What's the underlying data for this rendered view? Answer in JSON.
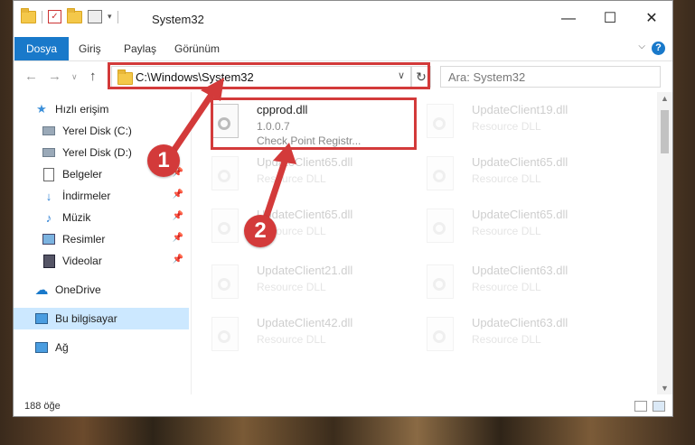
{
  "window": {
    "title": "System32",
    "controls": {
      "minimize": "—",
      "maximize": "☐",
      "close": "✕"
    }
  },
  "ribbon": {
    "tabs": [
      "Dosya",
      "Giriş",
      "Paylaş",
      "Görünüm"
    ],
    "help": "?"
  },
  "address": {
    "path": "C:\\Windows\\System32",
    "search_placeholder": "Ara: System32"
  },
  "nav": {
    "items": [
      {
        "label": "Hızlı erişim",
        "icon": "star-icon",
        "pinned": false
      },
      {
        "label": "Yerel Disk (C:)",
        "icon": "drive-icon",
        "pinned": false
      },
      {
        "label": "Yerel Disk (D:)",
        "icon": "drive-icon",
        "pinned": false
      },
      {
        "label": "Belgeler",
        "icon": "documents-icon",
        "pinned": true
      },
      {
        "label": "İndirmeler",
        "icon": "download-icon",
        "pinned": true
      },
      {
        "label": "Müzik",
        "icon": "music-icon",
        "pinned": true
      },
      {
        "label": "Resimler",
        "icon": "pictures-icon",
        "pinned": true
      },
      {
        "label": "Videolar",
        "icon": "videos-icon",
        "pinned": true
      },
      {
        "label": "OneDrive",
        "icon": "cloud-icon",
        "pinned": false
      },
      {
        "label": "Bu bilgisayar",
        "icon": "computer-icon",
        "pinned": false,
        "selected": true
      },
      {
        "label": "Ağ",
        "icon": "network-icon",
        "pinned": false
      }
    ]
  },
  "files": [
    {
      "name": "cpprod.dll",
      "line2": "1.0.0.7",
      "line3": "Check Point Registr..."
    },
    {
      "name": "UpdateClient19.dll",
      "line2": "Resource DLL"
    },
    {
      "name": "UpdateClient65.dll",
      "line2": "Resource DLL"
    },
    {
      "name": "UpdateClient65.dll",
      "line2": "Resource DLL"
    },
    {
      "name": "UpdateClient65.dll",
      "line2": "Resource DLL"
    },
    {
      "name": "UpdateClient65.dll",
      "line2": "Resource DLL"
    },
    {
      "name": "UpdateClient21.dll",
      "line2": "Resource DLL"
    },
    {
      "name": "UpdateClient63.dll",
      "line2": "Resource DLL"
    },
    {
      "name": "UpdateClient42.dll",
      "line2": "Resource DLL"
    },
    {
      "name": "UpdateClient63.dll",
      "line2": "Resource DLL"
    }
  ],
  "status": {
    "count": "188 öğe"
  },
  "annotations": {
    "step1": "1",
    "step2": "2"
  }
}
